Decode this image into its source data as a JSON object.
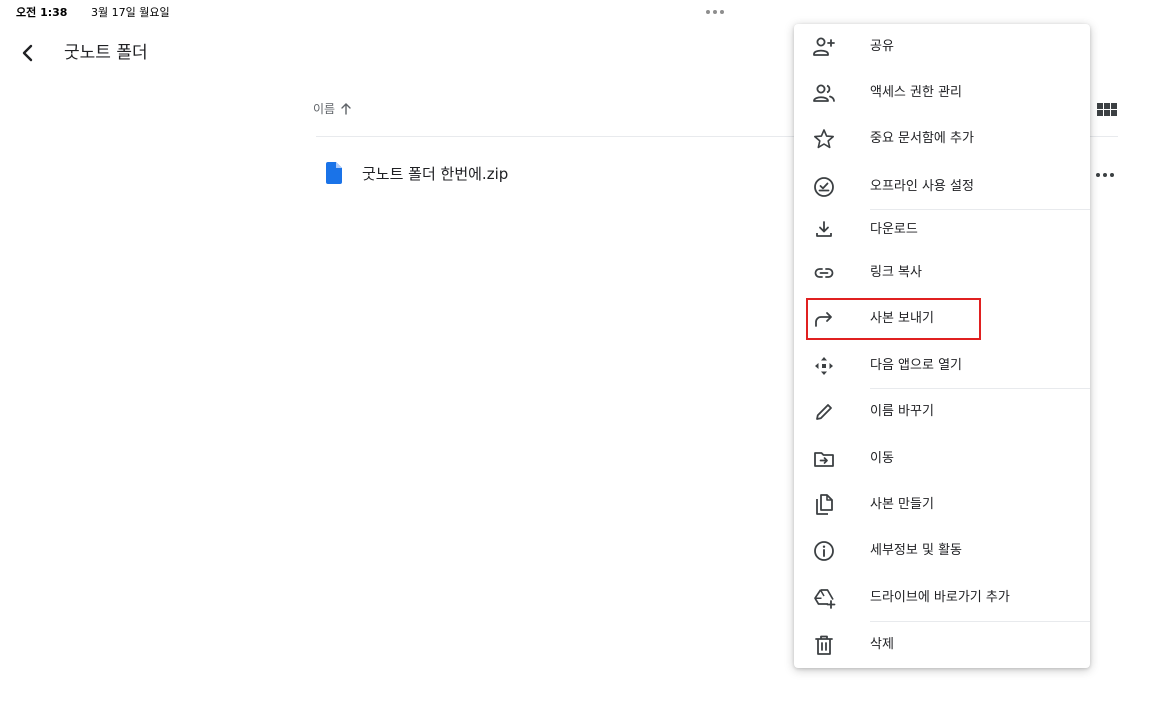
{
  "status_bar": {
    "time": "오전 1:38",
    "date": "3월 17일 월요일"
  },
  "header": {
    "title": "굿노트 폴더"
  },
  "list": {
    "sort_label": "이름",
    "files": [
      {
        "name": "굿노트 폴더 한번에.zip"
      }
    ]
  },
  "menu": {
    "items": [
      {
        "label": "공유",
        "icon": "person-add-icon"
      },
      {
        "label": "액세스 권한 관리",
        "icon": "people-icon"
      },
      {
        "label": "중요 문서함에 추가",
        "icon": "star-icon"
      },
      {
        "label": "오프라인 사용 설정",
        "icon": "offline-check-icon"
      },
      {
        "label": "다운로드",
        "icon": "download-icon"
      },
      {
        "label": "링크 복사",
        "icon": "link-icon"
      },
      {
        "label": "사본 보내기",
        "icon": "send-copy-icon"
      },
      {
        "label": "다음 앱으로 열기",
        "icon": "open-with-icon"
      },
      {
        "label": "이름 바꾸기",
        "icon": "pencil-icon"
      },
      {
        "label": "이동",
        "icon": "move-folder-icon"
      },
      {
        "label": "사본 만들기",
        "icon": "copy-icon"
      },
      {
        "label": "세부정보 및 활동",
        "icon": "info-icon"
      },
      {
        "label": "드라이브에 바로가기 추가",
        "icon": "drive-shortcut-icon"
      },
      {
        "label": "삭제",
        "icon": "trash-icon"
      }
    ]
  },
  "colors": {
    "file_icon": "#1a73e8",
    "menu_icon": "#3c4043",
    "highlight": "#e02020",
    "divider": "#e8eaed"
  }
}
